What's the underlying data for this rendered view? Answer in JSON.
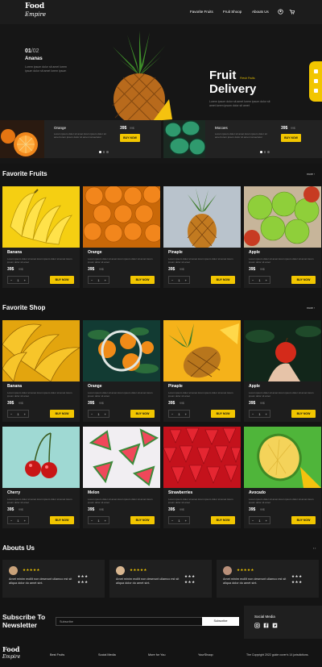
{
  "brand": {
    "line1": "Food",
    "line2": "Empire"
  },
  "nav": {
    "items": [
      "Favorite Fruits",
      "Fruit Shoop",
      "Abouts Us"
    ]
  },
  "hero": {
    "counter_current": "01",
    "counter_total": "/02",
    "product_name": "Ananas",
    "product_desc": "Lorem ipsum dolor sit amet lorem ipsum dolor sit amet lorem ipsum",
    "title": "Fruit Delivery",
    "script": "Fresh Fruits",
    "subtitle": "Lorem ipsum dolor sit amet lorem ipsum dolor sit amet lorem ipsum dolor sit amet"
  },
  "slides": [
    {
      "name": "Orange",
      "desc": "Lorem ipsum dolor sit amet lorem ipsum dolor sit amet lorem ipsum dolor sit amet consectetur",
      "price": "39$",
      "old": "99$",
      "button": "BUY NOW"
    },
    {
      "name": "Mocoes",
      "desc": "Lorem ipsum dolor sit amet lorem ipsum dolor sit amet lorem ipsum dolor sit amet consectetur",
      "price": "39$",
      "old": "99$",
      "button": "BUY NOW"
    }
  ],
  "sections": {
    "favorite_fruits": {
      "title": "Favorite Fruits",
      "more": "more ›"
    },
    "favorite_shop": {
      "title": "Favorite Shop",
      "more": "more ›"
    },
    "about": {
      "title": "Abouts Us",
      "more": "‹ ›"
    }
  },
  "card_common": {
    "desc": "Lorem ipsum dolor sit amet lorem ipsum dolor sit amet lorem ipsum dolor sit amet",
    "price": "39$",
    "old": "99$",
    "qty": "1",
    "minus": "−",
    "plus": "+",
    "button": "BUY NOW"
  },
  "favorite_fruits": [
    "Banana",
    "Orange",
    "Pinaple",
    "Apple"
  ],
  "favorite_shop": [
    "Banana",
    "Orange",
    "Pinaple",
    "Apple",
    "Cherry",
    "Melon",
    "Strawberries",
    "Avocado"
  ],
  "testimonials": [
    {
      "stars": "★★★★★",
      "text": "Amet minim mollit non deserunt ullamco est sit aliqua dolor do amet sint.",
      "rating": "★★★ ★★★"
    },
    {
      "stars": "★★★★★",
      "text": "Amet minim mollit non deserunt ullamco est sit aliqua dolor do amet sint.",
      "rating": "★★★ ★★★"
    },
    {
      "stars": "★★★★★",
      "text": "Amet minim mollit non deserunt ullamco est sit aliqua dolor do amet sint.",
      "rating": "★★★ ★★★"
    }
  ],
  "newsletter": {
    "title": "Subscribe To Newsletter",
    "placeholder": "Subscribe",
    "button": "Subscribe"
  },
  "social": {
    "title": "Social Media"
  },
  "footer": {
    "links": [
      "Best Fruits",
      "Social Media",
      "More for You",
      "YourShoop"
    ],
    "copyright": "The Copyright 2022 guide cover’s 14 jurisdictions."
  },
  "colors": {
    "accent": "#f2c600",
    "bg": "#141414",
    "card": "#1d1d1d"
  }
}
